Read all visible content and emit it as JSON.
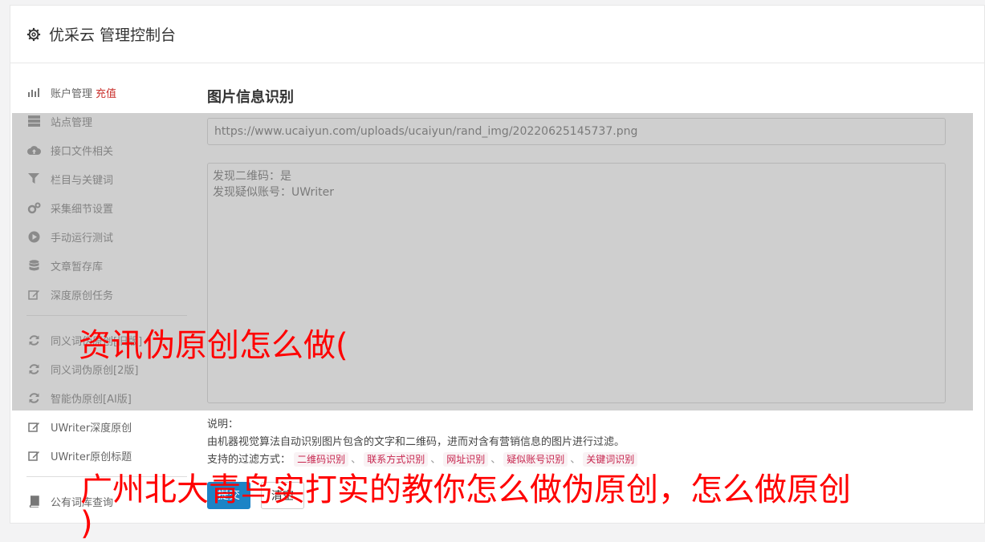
{
  "header": {
    "title": "优采云 管理控制台"
  },
  "sidebar": {
    "items": [
      {
        "label": "账户管理",
        "badge": "充值",
        "icon": "bar-chart-icon"
      },
      {
        "label": "站点管理",
        "icon": "server-icon"
      },
      {
        "label": "接口文件相关",
        "icon": "cloud-upload-icon"
      },
      {
        "label": "栏目与关键词",
        "icon": "filter-icon"
      },
      {
        "label": "采集细节设置",
        "icon": "cogs-icon"
      },
      {
        "label": "手动运行测试",
        "icon": "play-circle-icon"
      },
      {
        "label": "文章暂存库",
        "icon": "database-icon"
      },
      {
        "label": "深度原创任务",
        "icon": "edit-icon"
      },
      {
        "label": "同义词伪原创[旧版]",
        "icon": "refresh-icon"
      },
      {
        "label": "同义词伪原创[2版]",
        "icon": "refresh-icon"
      },
      {
        "label": "智能伪原创[AI版]",
        "icon": "refresh-icon"
      },
      {
        "label": "UWriter深度原创",
        "icon": "edit-icon"
      },
      {
        "label": "UWriter原创标题",
        "icon": "edit-icon"
      },
      {
        "label": "公有词库查询",
        "icon": "book-icon"
      }
    ]
  },
  "main": {
    "title": "图片信息识别",
    "url_value": "https://www.ucaiyun.com/uploads/ucaiyun/rand_img/20220625145737.png",
    "result_lines": [
      "发现二维码：是",
      "发现疑似账号：UWriter"
    ],
    "explain_label": "说明：",
    "explain_text": "由机器视觉算法自动识别图片包含的文字和二维码，进而对含有营销信息的图片进行过滤。",
    "filter_label": "支持的过滤方式：",
    "filter_tags": [
      "二维码识别",
      "联系方式识别",
      "网址识别",
      "疑似账号识别",
      "关键词识别"
    ],
    "separator": "、",
    "submit_label": "提交",
    "reset_label": "清空"
  },
  "watermark": {
    "line1": "资讯伪原创怎么做(",
    "line2": "广州北大青鸟实打实的教你怎么做伪原创，怎么做原创",
    "line3": ")"
  },
  "colors": {
    "primary": "#1c84c6",
    "badge": "#c9302c",
    "watermark": "#ff0000",
    "tag_text": "#c7254e"
  }
}
